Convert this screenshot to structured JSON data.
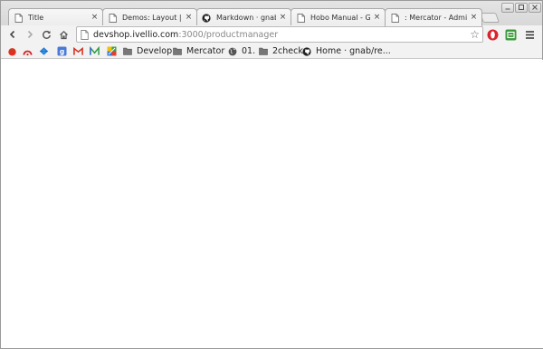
{
  "tabs": [
    {
      "title": "Title",
      "icon": "page-icon",
      "active": false
    },
    {
      "title": "Demos: Layout | JavaScript",
      "icon": "page-icon",
      "active": false
    },
    {
      "title": "Markdown · gnab/remark",
      "icon": "github-icon",
      "active": false
    },
    {
      "title": "Hobo Manual - Generators",
      "icon": "page-icon",
      "active": false
    },
    {
      "title": ": Mercator - Administration",
      "icon": "page-icon",
      "active": true
    }
  ],
  "tab_close_glyph": "×",
  "address": {
    "host": "devshop.ivellio.com",
    "port": ":3000",
    "path": "/productmanager"
  },
  "bookmarks": [
    {
      "label": "Develop",
      "icon": "folder-icon"
    },
    {
      "label": "Mercator",
      "icon": "folder-icon"
    },
    {
      "label": "01.",
      "icon": "globe-icon"
    },
    {
      "label": "2check",
      "icon": "folder-icon"
    },
    {
      "label": "Home · gnab/re...",
      "icon": "github-icon"
    }
  ],
  "bookmark_icons": [
    "tomato-icon",
    "rss-arc-icon",
    "diamond-icon",
    "google-plus-icon",
    "gmail-icon",
    "m-logo-icon",
    "colorful-app-icon"
  ],
  "colors": {
    "tab_strip": "#dcdcdc",
    "toolbar": "#f2f2f2",
    "opera_red": "#d9232e",
    "green_ext": "#3a9a3a"
  }
}
